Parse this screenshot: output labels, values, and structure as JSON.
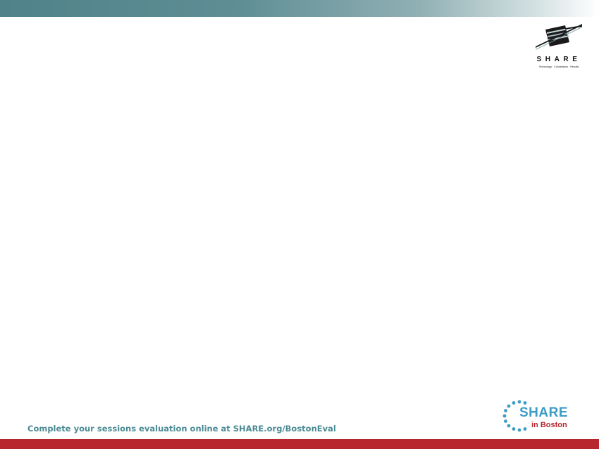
{
  "header": {
    "logo_word": "SHARE",
    "logo_tagline": "Technology · Connections · Results",
    "logo_icon": "share-striped-bar-logo"
  },
  "footer": {
    "evaluation_text": "Complete your sessions evaluation online at SHARE.org/BostonEval",
    "event_logo_word": "SHARE",
    "event_logo_city": "in Boston",
    "event_logo_icon": "dotted-circle-logo"
  },
  "colors": {
    "top_bar_start": "#4f8289",
    "footer_text": "#4a8a93",
    "event_logo_blue": "#3d9cc4",
    "event_logo_red": "#b5262e",
    "bottom_bar": "#b8262e"
  }
}
